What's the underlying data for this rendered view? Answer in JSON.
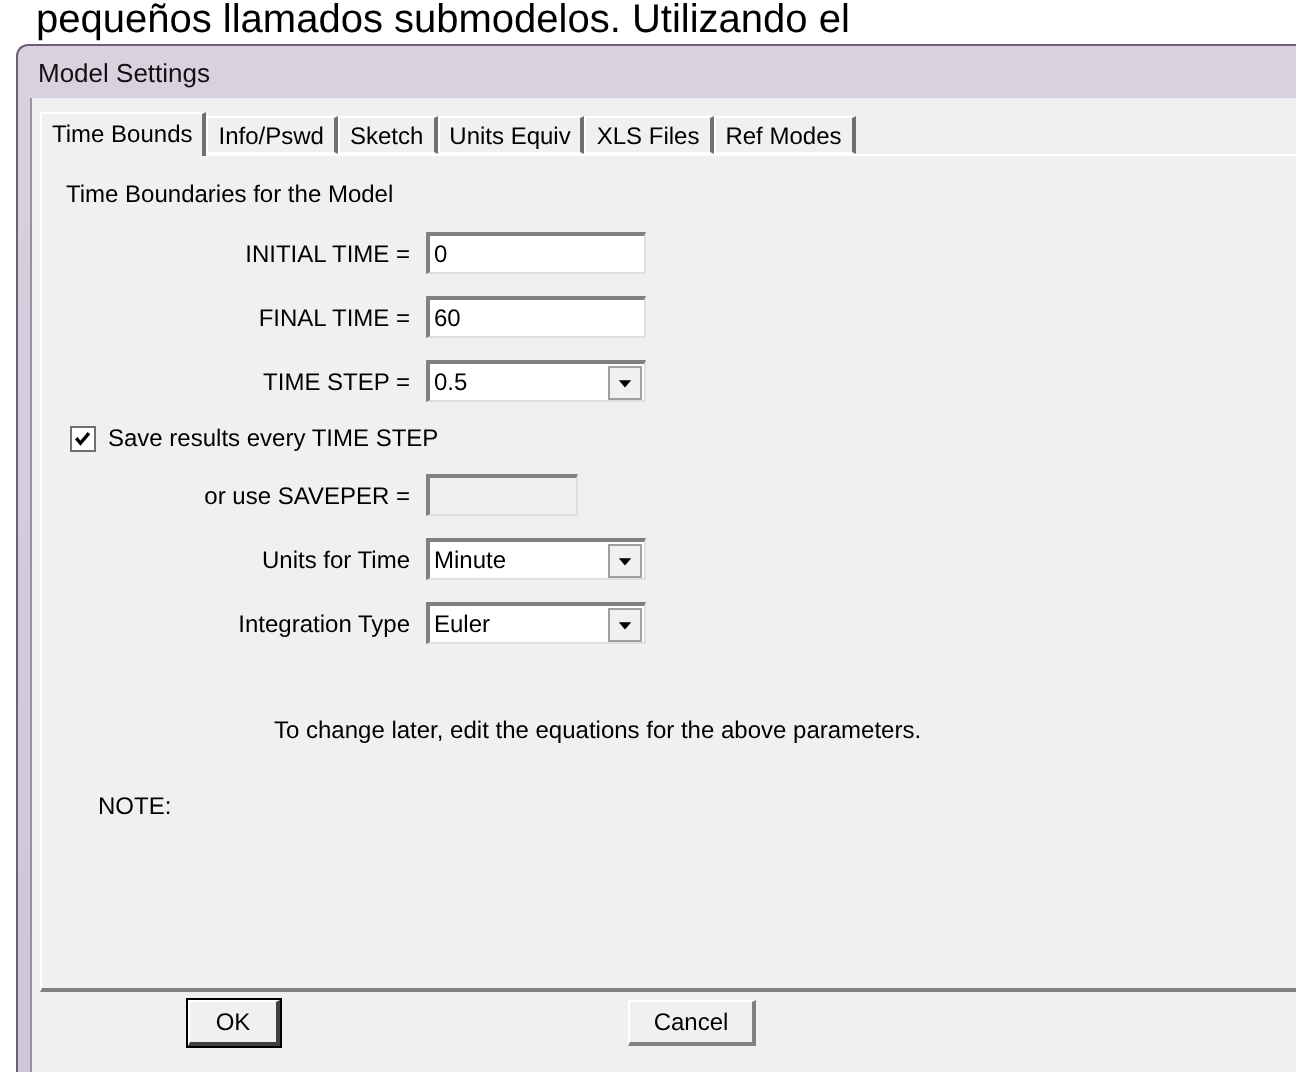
{
  "background_text": "pequeños llamados submodelos. Utilizando el",
  "window": {
    "title": "Model Settings"
  },
  "tabs": [
    {
      "label": "Time Bounds",
      "selected": true
    },
    {
      "label": "Info/Pswd",
      "selected": false
    },
    {
      "label": "Sketch",
      "selected": false
    },
    {
      "label": "Units Equiv",
      "selected": false
    },
    {
      "label": "XLS Files",
      "selected": false
    },
    {
      "label": "Ref Modes",
      "selected": false
    }
  ],
  "heading": "Time Boundaries for the Model",
  "fields": [
    {
      "kind": "text",
      "label": "INITIAL TIME =",
      "value": "0"
    },
    {
      "kind": "text",
      "label": "FINAL TIME =",
      "value": "60"
    },
    {
      "kind": "dropdown",
      "label": "TIME STEP =",
      "value": "0.5"
    },
    {
      "kind": "checkbox",
      "label": "Save results every TIME STEP",
      "checked": true
    },
    {
      "kind": "text",
      "label": "or use SAVEPER =",
      "disabled": true
    },
    {
      "kind": "dropdown",
      "label": "Units for Time",
      "value": "Minute"
    },
    {
      "kind": "dropdown",
      "label": "Integration Type",
      "value": "Euler"
    }
  ],
  "hint": "To change later, edit the equations for the above parameters.",
  "note_label": "NOTE:",
  "buttons": [
    {
      "label": "OK",
      "default": true
    },
    {
      "label": "Cancel",
      "default": false
    }
  ]
}
